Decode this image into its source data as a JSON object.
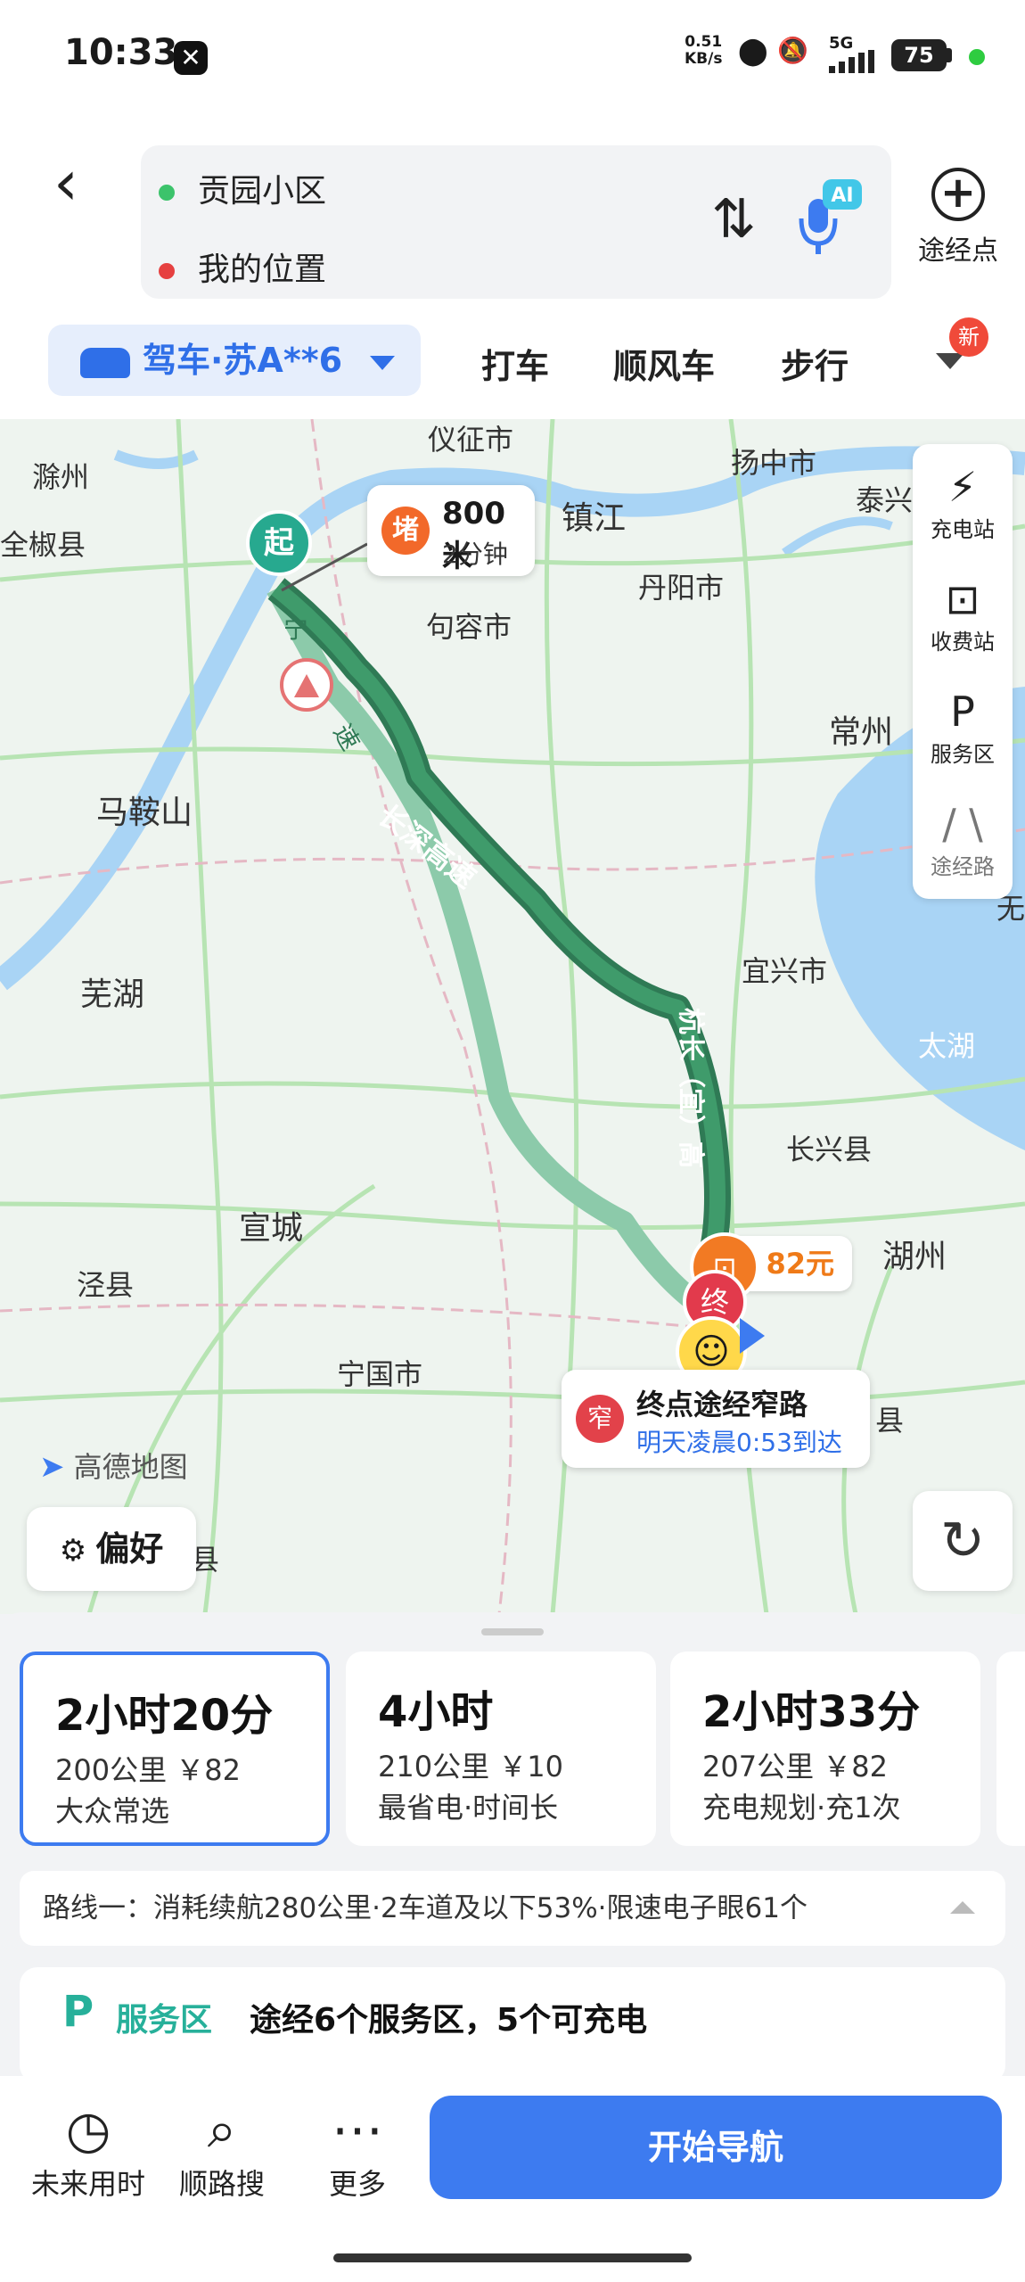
{
  "status_bar": {
    "time": "10:33",
    "net_speed_value": "0.51",
    "net_speed_unit": "KB/s",
    "network": "5G",
    "battery": "75"
  },
  "header": {
    "origin": "贡园小区",
    "destination": "我的位置",
    "add_waypoint": "途经点",
    "ai_label": "AI"
  },
  "modes": {
    "drive": "驾车·苏A**6",
    "taxi": "打车",
    "carpool": "顺风车",
    "walk": "步行",
    "new_badge": "新"
  },
  "map": {
    "cities": {
      "yizheng": "仪征市",
      "yangzhong": "扬中市",
      "chuzhou": "滁州",
      "quanjiao": "全椒县",
      "zhenjiang": "镇江",
      "danyang": "丹阳市",
      "jurong": "句容市",
      "taixing": "泰兴",
      "changzhou": "常州",
      "maanshan": "马鞍山",
      "wuhu": "芜湖",
      "yixing": "宜兴市",
      "taihu": "太湖",
      "changxing": "长兴县",
      "huzhou": "湖州",
      "xuancheng": "宣城",
      "jingxian": "泾县",
      "ningguo": "宁国市",
      "edge_right": "无",
      "edge_county": "县",
      "edge_bottom": "县"
    },
    "roads": {
      "ning": "宁",
      "su": "速",
      "changshen": "长深高速",
      "hangchang": "杭长（宜）高"
    },
    "jam": {
      "badge": "堵",
      "distance": "800米",
      "time": "2分钟"
    },
    "start_marker": "起",
    "end_marker": "终",
    "toll": "82元",
    "end_notice": {
      "badge": "窄",
      "title": "终点途经窄路",
      "arrival": "明天凌晨0:53到达"
    },
    "logo": "高德地图",
    "preference": "偏好"
  },
  "side_tools": [
    {
      "icon": "charging-icon",
      "label": "充电站"
    },
    {
      "icon": "toll-icon",
      "label": "收费站"
    },
    {
      "icon": "service-area-icon",
      "label": "服务区"
    },
    {
      "icon": "waypoint-road-icon",
      "label": "途经路"
    }
  ],
  "routes": [
    {
      "time": "2小时20分",
      "dist": "200公里 ￥82",
      "tag": "大众常选",
      "selected": true
    },
    {
      "time": "4小时",
      "dist": "210公里 ￥10",
      "tag": "最省电·时间长",
      "selected": false
    },
    {
      "time": "2小时33分",
      "dist": "207公里 ￥82",
      "tag": "充电规划·充1次",
      "selected": false
    }
  ],
  "route_info": "路线一：消耗续航280公里·2车道及以下53%·限速电子眼61个",
  "service": {
    "label": "服务区",
    "text": "途经6个服务区，5个可充电"
  },
  "bottom_bar": {
    "future": "未来用时",
    "search": "顺路搜",
    "more": "更多",
    "start_nav": "开始导航"
  },
  "colors": {
    "accent": "#3d7bf0",
    "route_main": "#2f7a55",
    "route_alt": "#8ccaaa",
    "water": "#a9d4f5",
    "road": "#b7e4b3"
  }
}
